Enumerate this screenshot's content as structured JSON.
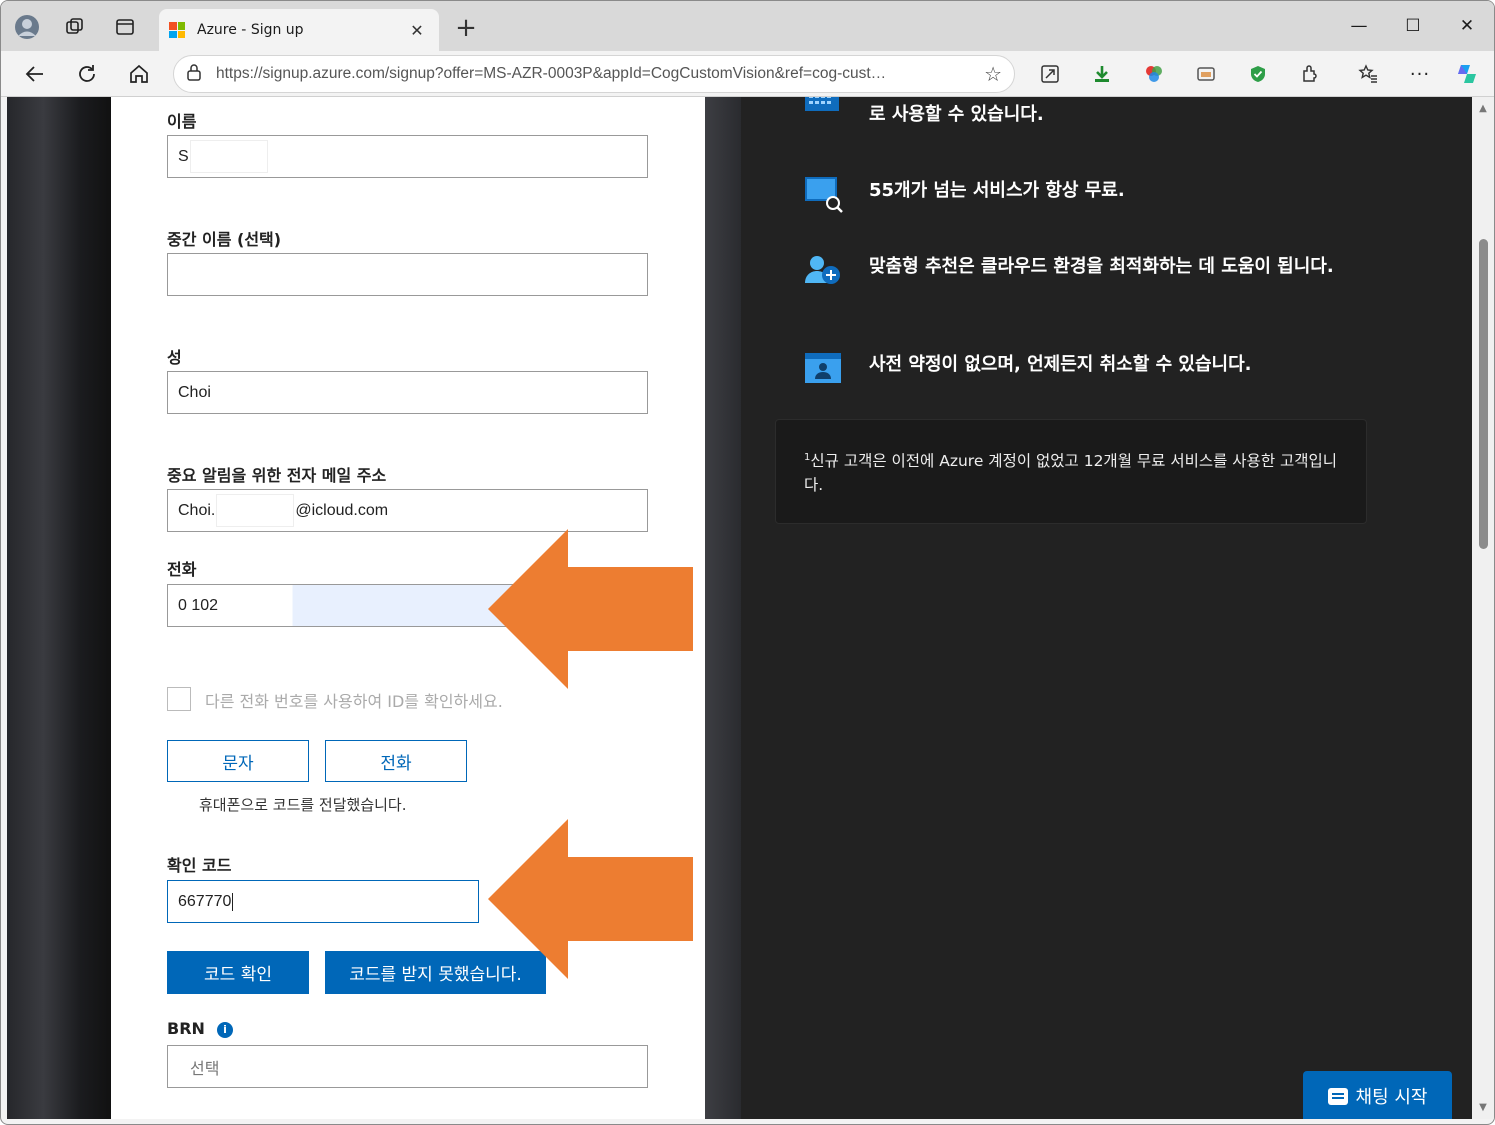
{
  "browser": {
    "tab_title": "Azure - Sign up",
    "new_tab_label": "+",
    "url": "https://signup.azure.com/signup?offer=MS-AZR-0003P&appId=CogCustomVision&ref=cog-cust…",
    "window_controls": {
      "minimize": "—",
      "maximize": "☐",
      "close": "✕"
    },
    "icons": {
      "profile": "profile-icon",
      "workspaces": "workspaces-icon",
      "tab_actions": "vertical-tabs-icon",
      "back": "back-arrow-icon",
      "refresh": "refresh-icon",
      "home": "home-icon",
      "lock": "lock-icon",
      "favorite": "star-icon"
    }
  },
  "form": {
    "first_name": {
      "label": "이름",
      "value": "S"
    },
    "middle_name": {
      "label": "중간 이름 (선택)",
      "value": ""
    },
    "last_name": {
      "label": "성",
      "value": "Choi"
    },
    "email": {
      "label": "중요 알림을 위한 전자 메일 주소",
      "value_prefix": "Choi.",
      "value_suffix": "@icloud.com"
    },
    "phone": {
      "label": "전화",
      "value": "0 102"
    },
    "alt_phone_checkbox": {
      "label": "다른 전화 번호를 사용하여 ID를 확인하세요.",
      "checked": false
    },
    "text_button": "문자",
    "call_button": "전화",
    "code_sent_note": "휴대폰으로 코드를 전달했습니다.",
    "verification_code": {
      "label": "확인 코드",
      "value": "667770"
    },
    "verify_button": "코드 확인",
    "not_received_button": "코드를 받지 못했습니다.",
    "brn": {
      "label": "BRN",
      "placeholder": "선택"
    }
  },
  "benefits": {
    "items": [
      {
        "text": "로 사용할 수 있습니다.",
        "icon": "calendar-icon"
      },
      {
        "text": "55개가 넘는 서비스가 항상 무료.",
        "icon": "monitor-search-icon"
      },
      {
        "text": "맞춤형 추천은 클라우드 환경을 최적화하는 데 도움이 됩니다.",
        "icon": "user-add-icon"
      },
      {
        "text": "사전 약정이 없으며, 언제든지 취소할 수 있습니다.",
        "icon": "id-card-icon"
      }
    ],
    "footnote_marker": "1",
    "footnote": "신규 고객은 이전에 Azure 계정이 없었고 12개월 무료 서비스를 사용한 고객입니다."
  },
  "chat": {
    "label": "채팅 시작"
  },
  "colors": {
    "accent": "#0067b8",
    "arrow": "#ed7d31",
    "panel": "#222222"
  }
}
